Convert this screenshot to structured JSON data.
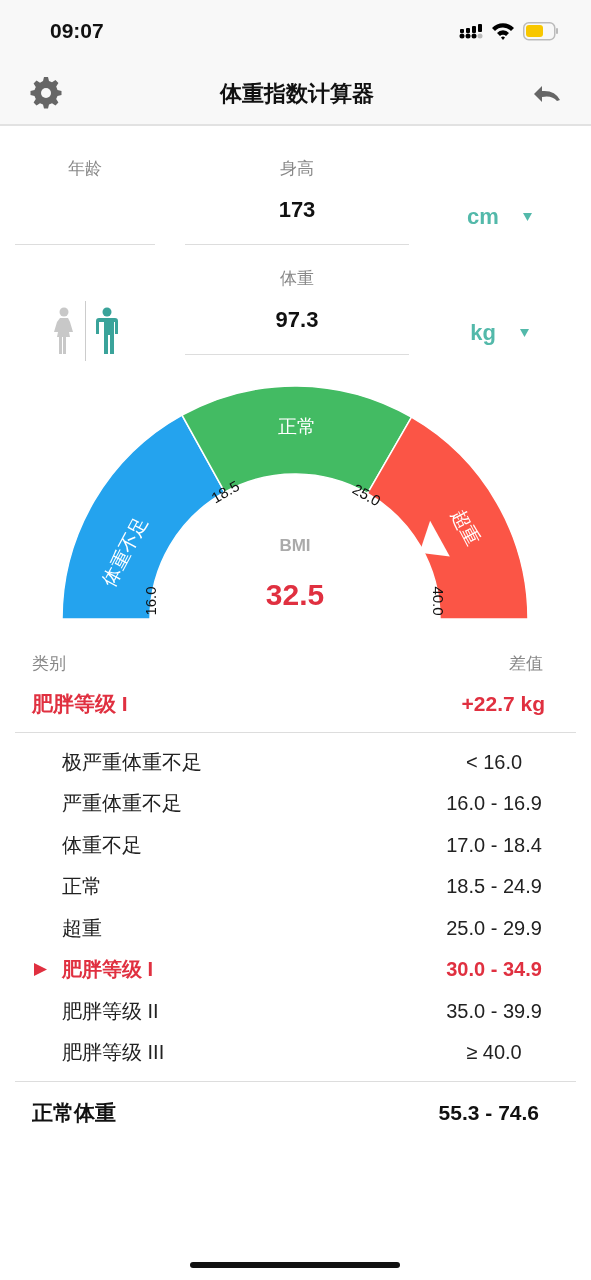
{
  "status_bar": {
    "time": "09:07"
  },
  "header": {
    "title": "体重指数计算器"
  },
  "inputs": {
    "age": {
      "label": "年龄"
    },
    "height": {
      "label": "身高",
      "value": "173",
      "unit": "cm"
    },
    "weight": {
      "label": "体重",
      "value": "97.3",
      "unit": "kg"
    },
    "genders": [
      {
        "kind": "female",
        "selected": false
      },
      {
        "kind": "male",
        "selected": true
      }
    ]
  },
  "gauge": {
    "segments": [
      {
        "label": "体重不足",
        "color": "#24a3ee"
      },
      {
        "label": "正常",
        "color": "#43bb63"
      },
      {
        "label": "超重",
        "color": "#fb5546"
      }
    ],
    "ticks": [
      "16.0",
      "18.5",
      "25.0",
      "40.0"
    ],
    "bmi_label": "BMI",
    "bmi_value": "32.5"
  },
  "result": {
    "category_header": "类别",
    "difference_header": "差值",
    "category": "肥胖等级 I",
    "difference": "+22.7 kg"
  },
  "table": {
    "rows": [
      {
        "label": "极严重体重不足",
        "range": "< 16.0",
        "selected": false
      },
      {
        "label": "严重体重不足",
        "range": "16.0 - 16.9",
        "selected": false
      },
      {
        "label": "体重不足",
        "range": "17.0 - 18.4",
        "selected": false
      },
      {
        "label": "正常",
        "range": "18.5 - 24.9",
        "selected": false
      },
      {
        "label": "超重",
        "range": "25.0 - 29.9",
        "selected": false
      },
      {
        "label": "肥胖等级 I",
        "range": "30.0 - 34.9",
        "selected": true
      },
      {
        "label": "肥胖等级 II",
        "range": "35.0 - 39.9",
        "selected": false
      },
      {
        "label": "肥胖等级 III",
        "range": "≥ 40.0",
        "selected": false
      }
    ]
  },
  "normal_weight": {
    "label": "正常体重",
    "range": "55.3 - 74.6"
  }
}
